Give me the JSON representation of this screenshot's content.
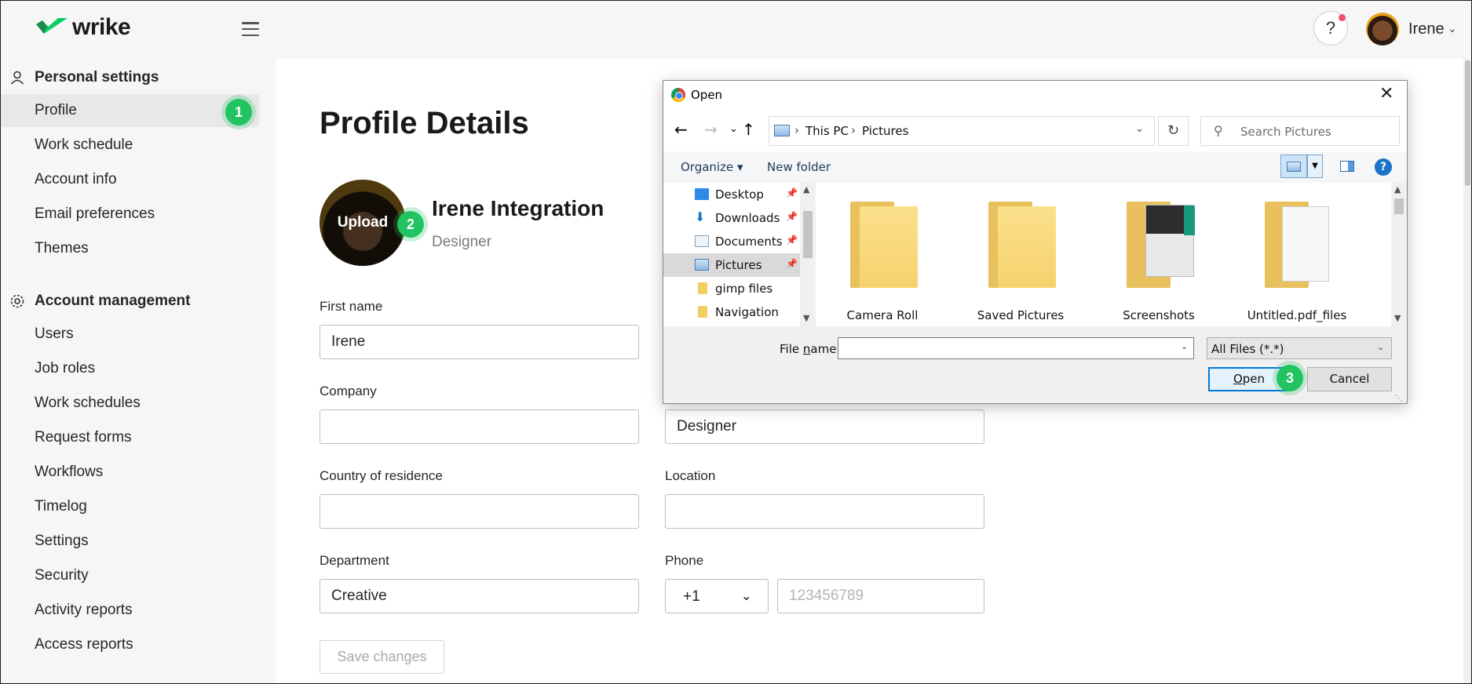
{
  "app": {
    "logo_text": "wrike",
    "help_label": "?",
    "user_name": "Irene"
  },
  "sidebar": {
    "personal_heading": "Personal settings",
    "personal_items": [
      {
        "label": "Profile",
        "active": true
      },
      {
        "label": "Work schedule"
      },
      {
        "label": "Account info"
      },
      {
        "label": "Email preferences"
      },
      {
        "label": "Themes"
      }
    ],
    "account_heading": "Account management",
    "account_items": [
      {
        "label": "Users"
      },
      {
        "label": "Job roles"
      },
      {
        "label": "Work schedules"
      },
      {
        "label": "Request forms"
      },
      {
        "label": "Workflows"
      },
      {
        "label": "Timelog"
      },
      {
        "label": "Settings"
      },
      {
        "label": "Security"
      },
      {
        "label": "Activity reports"
      },
      {
        "label": "Access reports"
      }
    ]
  },
  "steps": [
    "1",
    "2",
    "3"
  ],
  "profile": {
    "title": "Profile Details",
    "upload_label": "Upload",
    "name": "Irene Integration",
    "role": "Designer",
    "fields": {
      "first_name_label": "First name",
      "first_name_value": "Irene",
      "company_label": "Company",
      "company_value": "",
      "job_title_value": "Designer",
      "country_label": "Country of residence",
      "country_value": "",
      "location_label": "Location",
      "location_value": "",
      "department_label": "Department",
      "department_value": "Creative",
      "phone_label": "Phone",
      "phone_code": "+1",
      "phone_placeholder": "123456789"
    },
    "save_label": "Save changes"
  },
  "dialog": {
    "title": "Open",
    "breadcrumb": [
      "This PC",
      "Pictures"
    ],
    "search_placeholder": "Search Pictures",
    "organize_label": "Organize",
    "new_folder_label": "New folder",
    "help_label": "?",
    "tree": [
      {
        "label": "Desktop",
        "pinned": true,
        "icon": "desktop-icon"
      },
      {
        "label": "Downloads",
        "pinned": true,
        "icon": "download-icon"
      },
      {
        "label": "Documents",
        "pinned": true,
        "icon": "documents-icon"
      },
      {
        "label": "Pictures",
        "pinned": true,
        "selected": true,
        "icon": "pictures-icon"
      },
      {
        "label": "gimp files",
        "icon": "folder-icon"
      },
      {
        "label": "Navigation",
        "icon": "folder-icon"
      }
    ],
    "files": [
      {
        "label": "Camera Roll",
        "kind": "folder"
      },
      {
        "label": "Saved Pictures",
        "kind": "folder"
      },
      {
        "label": "Screenshots",
        "kind": "screenshots"
      },
      {
        "label": "Untitled.pdf_files",
        "kind": "documents"
      }
    ],
    "file_name_label_pre": "File ",
    "file_name_label_u": "n",
    "file_name_label_post": "ame:",
    "file_name_value": "",
    "filter_value": "All Files (*.*)",
    "open_label_u": "O",
    "open_label_rest": "pen",
    "cancel_label": "Cancel"
  },
  "colors": {
    "accent_green": "#22c462",
    "brand_green": "#08cf65",
    "dialog_primary": "#0078d7"
  }
}
